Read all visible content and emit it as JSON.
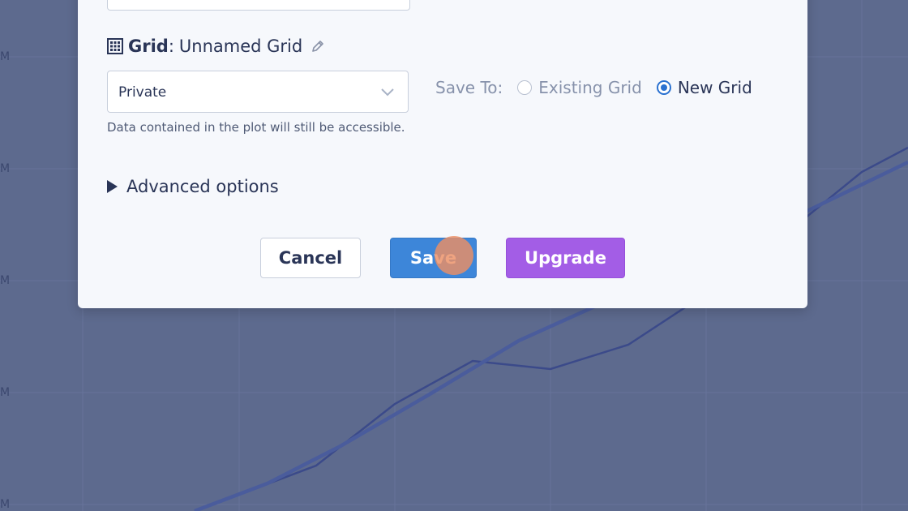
{
  "background": {
    "axis_tick_label": "M",
    "overlay_color": "#5d6a8e",
    "line_color": "#3b4a8a"
  },
  "dialog": {
    "grid_label": "Grid",
    "grid_name": "Unnamed Grid",
    "privacy": {
      "selected": "Private",
      "help_text": "Data contained in the plot will still be accessible."
    },
    "save_to": {
      "label": "Save To:",
      "options": [
        {
          "label": "Existing Grid",
          "selected": false
        },
        {
          "label": "New Grid",
          "selected": true
        }
      ]
    },
    "advanced_options_label": "Advanced options",
    "buttons": {
      "cancel": "Cancel",
      "save": "Save",
      "upgrade": "Upgrade"
    }
  },
  "colors": {
    "primary": "#3d86d9",
    "upgrade": "#a35de6",
    "radio_selected": "#2a71d0",
    "text_dark": "#2a3557"
  }
}
